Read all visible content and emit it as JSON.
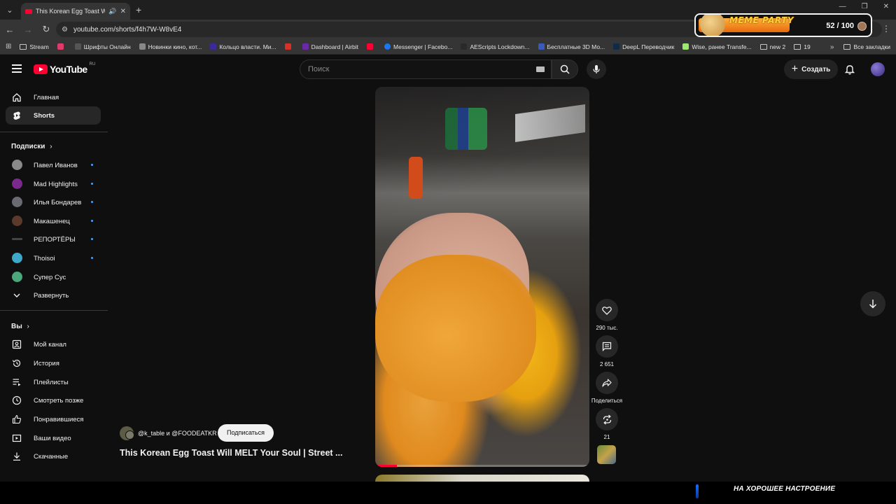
{
  "browser": {
    "tab_title": "This Korean Egg Toast Will M",
    "url": "youtube.com/shorts/f4h7W-W8vE4",
    "bookmarks": [
      "Stream",
      "",
      "Шрифты Онлайн",
      "Новинки кино, кот...",
      "Кольцо власти. Ми...",
      "",
      "Dashboard | Airbit",
      "",
      "Messenger | Facebo...",
      "AEScripts Lockdown...",
      "Бесплатные 3D Мо...",
      "DeepL Переводчик",
      "Wise, ранее Transfe...",
      "new 2",
      "19"
    ],
    "all_bookmarks": "Все закладки"
  },
  "overlay": {
    "meme_title": "MEME PARTY",
    "meme_count": "52 / 100",
    "bottom_text": "НА ХОРОШЕЕ НАСТРОЕНИЕ"
  },
  "header": {
    "logo": "YouTube",
    "region": "RU",
    "search_placeholder": "Поиск",
    "create_label": "Создать"
  },
  "sidebar": {
    "main": [
      {
        "label": "Главная",
        "icon": "home-icon"
      },
      {
        "label": "Shorts",
        "icon": "shorts-icon"
      }
    ],
    "subscriptions_title": "Подписки",
    "subscriptions": [
      {
        "label": "Павел Иванов",
        "color": "#8a8a8a"
      },
      {
        "label": "Mad Highlights",
        "color": "#7a2a8a"
      },
      {
        "label": "Илья Бондарев",
        "color": "#6a6a72"
      },
      {
        "label": "Макашенец",
        "color": "#5a3a2a"
      },
      {
        "label": "РЕПОРТЁРЫ",
        "color": "#444444"
      },
      {
        "label": "Thoisoi",
        "color": "#3fa7c8"
      },
      {
        "label": "Супер Сус",
        "color": "#4aa87a"
      }
    ],
    "expand_label": "Развернуть",
    "you_title": "Вы",
    "you": [
      {
        "label": "Мой канал",
        "icon": "channel-icon"
      },
      {
        "label": "История",
        "icon": "history-icon"
      },
      {
        "label": "Плейлисты",
        "icon": "playlists-icon"
      },
      {
        "label": "Смотреть позже",
        "icon": "watch-later-icon"
      },
      {
        "label": "Понравившиеся",
        "icon": "like-icon"
      },
      {
        "label": "Ваши видео",
        "icon": "your-videos-icon"
      },
      {
        "label": "Скачанные",
        "icon": "download-icon"
      }
    ]
  },
  "short": {
    "channel": "@k_table и @FOODEATKR",
    "subscribe_label": "Подписаться",
    "title": "This Korean Egg Toast Will MELT Your Soul  | Street ...",
    "progress": 0.1,
    "likes": "290 тыс.",
    "comments": "2 651",
    "share_label": "Поделиться",
    "remixes": "21"
  }
}
